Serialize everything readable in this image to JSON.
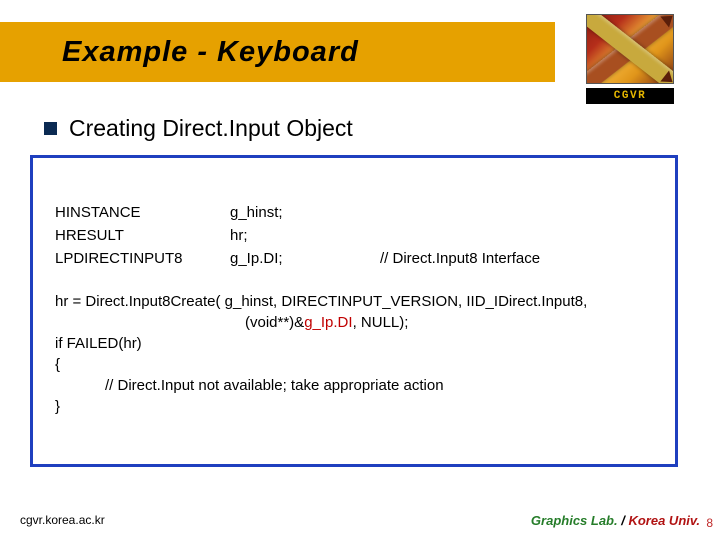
{
  "title": "Example - Keyboard",
  "logo_label": "CGVR",
  "heading": "Creating Direct.Input Object",
  "decl": {
    "r1c1": "HINSTANCE",
    "r1c2": "g_hinst;",
    "r1c3": "",
    "r2c1": "HRESULT",
    "r2c2": "hr;",
    "r2c3": "",
    "r3c1": "LPDIRECTINPUT8",
    "r3c2": "g_Ip.DI;",
    "r3c3": "// Direct.Input8 Interface"
  },
  "code": {
    "l1a": "hr = Direct.Input8Create( g_hinst, DIRECTINPUT_VERSION, IID_IDirect.Input8,",
    "l2a": "(void**)&",
    "l2red": "g_Ip.DI",
    "l2b": ", NULL);",
    "l3": "if FAILED(hr)",
    "l4": "{",
    "l5": "// Direct.Input not available; take appropriate action",
    "l6": "}"
  },
  "footer": {
    "left": "cgvr.korea.ac.kr",
    "right1": "Graphics Lab.",
    "right2": " / ",
    "right3": "Korea Univ."
  },
  "page_number": "8"
}
